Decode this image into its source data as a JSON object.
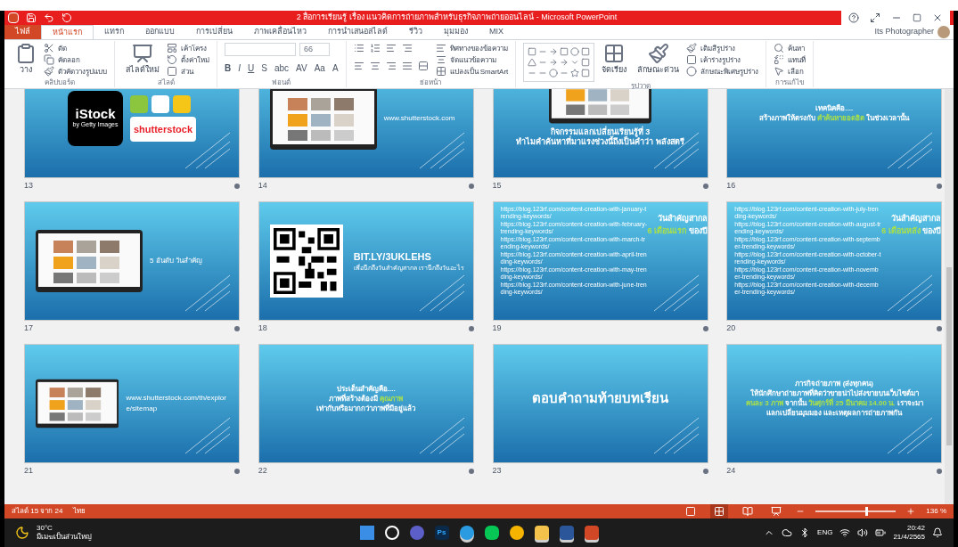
{
  "window": {
    "title": "2 สื่อการเรียนรู้ เรื่อง แนวคิดการถ่ายภาพสำหรับธุรกิจภาพถ่ายออนไลน์ - Microsoft PowerPoint"
  },
  "ribbon": {
    "tabs": [
      {
        "label": "ไฟล์",
        "kind": "file",
        "selected": false
      },
      {
        "label": "หน้าแรก",
        "kind": "tab",
        "selected": true
      },
      {
        "label": "แทรก",
        "kind": "tab",
        "selected": false
      },
      {
        "label": "ออกแบบ",
        "kind": "tab",
        "selected": false
      },
      {
        "label": "การเปลี่ยน",
        "kind": "tab",
        "selected": false
      },
      {
        "label": "ภาพเคลื่อนไหว",
        "kind": "tab",
        "selected": false
      },
      {
        "label": "การนำเสนอสไลด์",
        "kind": "tab",
        "selected": false
      },
      {
        "label": "รีวิว",
        "kind": "tab",
        "selected": false
      },
      {
        "label": "มุมมอง",
        "kind": "tab",
        "selected": false
      },
      {
        "label": "MIX",
        "kind": "tab",
        "selected": false
      }
    ],
    "account": "Its Photographer",
    "groups": [
      {
        "kind": "clipboard",
        "label": "คลิปบอร์ด",
        "big": [
          "วาง"
        ],
        "items": [
          "ตัด",
          "คัดลอก",
          "ตัวคัดวางรูปแบบ"
        ]
      },
      {
        "kind": "slides",
        "label": "สไลด์",
        "big": [
          "สไลด์ใหม่"
        ],
        "items": [
          "เค้าโครง",
          "ตั้งค่าใหม่",
          "ส่วน"
        ]
      },
      {
        "kind": "font",
        "label": "ฟอนต์",
        "font_size": "66",
        "format": [
          "B",
          "I",
          "U",
          "S",
          "abc",
          "AV",
          "Aa",
          "A"
        ]
      },
      {
        "kind": "paragraph",
        "label": "ย่อหน้า",
        "items": [
          "ทิศทางของข้อความ",
          "จัดแนวข้อความ",
          "แปลงเป็น SmartArt"
        ]
      },
      {
        "kind": "drawing",
        "label": "รูปวาด",
        "big": [
          "จัดเรียง",
          "ลักษณะด่วน"
        ],
        "items": [
          "เติมสีรูปร่าง",
          "เค้าร่างรูปร่าง",
          "ลักษณะพิเศษรูปร่าง"
        ]
      },
      {
        "kind": "editing",
        "label": "การแก้ไข",
        "items": [
          "ค้นหา",
          "แทนที่",
          "เลือก"
        ]
      }
    ]
  },
  "slides": [
    {
      "number": "13",
      "kind": "logos",
      "logo_main": "iStock",
      "logo_sub": "by Getty Images",
      "logo_second": "shutterstock"
    },
    {
      "number": "14",
      "kind": "screenshot",
      "caption": [
        [
          {
            "text": "www.shutterstock.com",
            "highlight": false
          }
        ]
      ]
    },
    {
      "number": "15",
      "kind": "screenshot_top",
      "caption": [
        [
          {
            "text": "กิจกรรมแลกเปลี่ยนเรียนรู้ที่ 3",
            "highlight": false
          }
        ],
        [
          {
            "text": "ทำไมคำค้นหาที่มาแรงช่วงนี้ถึงเป็นคำว่า พลังสตรี",
            "highlight": false
          }
        ]
      ]
    },
    {
      "number": "16",
      "kind": "text",
      "lines": [
        [
          {
            "text": "เทคนิคคือ....",
            "highlight": false
          }
        ],
        [
          {
            "text": "สร้างภาพให้ตรงกับ ",
            "highlight": false
          },
          {
            "text": "คำค้นหายอดฮิต",
            "highlight": true
          },
          {
            "text": " ในช่วงเวลานั้น",
            "highlight": false
          }
        ]
      ]
    },
    {
      "number": "17",
      "kind": "screenshot",
      "caption": [
        [
          {
            "text": "5 อันดับ วันสำคัญ",
            "highlight": false
          }
        ]
      ]
    },
    {
      "number": "18",
      "kind": "qr",
      "heading": "BIT.LY/3UKLEHS",
      "subtitle": "เพื่อนึกถึงวันสำคัญสากล เรานึกถึงวันอะไร"
    },
    {
      "number": "19",
      "kind": "links",
      "links": [
        "https://blog.123rf.com/content-creation-with-january-trending-keywords/",
        "https://blog.123rf.com/content-creation-with-february-trending-keywords/",
        "https://blog.123rf.com/content-creation-with-march-trending-keywords/",
        "https://blog.123rf.com/content-creation-with-april-trending-keywords/",
        "https://blog.123rf.com/content-creation-with-may-trending-keywords/",
        "https://blog.123rf.com/content-creation-with-june-trending-keywords/"
      ],
      "lines": [
        [
          {
            "text": "วันสำคัญสากล",
            "highlight": false
          }
        ],
        [
          {
            "text": "6 เดือนแรก",
            "highlight": true
          },
          {
            "text": " ของปี",
            "highlight": false
          }
        ]
      ]
    },
    {
      "number": "20",
      "kind": "links",
      "links": [
        "https://blog.123rf.com/content-creation-with-july-trending-keywords/",
        "https://blog.123rf.com/content-creation-with-august-trending-keywords/",
        "https://blog.123rf.com/content-creation-with-september-trending-keywords/",
        "https://blog.123rf.com/content-creation-with-october-trending-keywords/",
        "https://blog.123rf.com/content-creation-with-november-trending-keywords/",
        "https://blog.123rf.com/content-creation-with-december-trending-keywords/"
      ],
      "lines": [
        [
          {
            "text": "วันสำคัญสากล",
            "highlight": false
          }
        ],
        [
          {
            "text": "6 เดือนหลัง",
            "highlight": true
          },
          {
            "text": " ของปี",
            "highlight": false
          }
        ]
      ]
    },
    {
      "number": "21",
      "kind": "screenshot",
      "caption": [
        [
          {
            "text": "www.shutterstock.com/th/explore/sitemap",
            "highlight": false
          }
        ]
      ]
    },
    {
      "number": "22",
      "kind": "text",
      "lines": [
        [
          {
            "text": "ประเด็นสำคัญคือ....",
            "highlight": false
          }
        ],
        [
          {
            "text": "ภาพที่สร้างต้องมี ",
            "highlight": false
          },
          {
            "text": "คุณภาพ",
            "highlight": true
          }
        ],
        [
          {
            "text": "เท่ากับหรือมากกว่าภาพที่มีอยู่แล้ว",
            "highlight": false
          }
        ]
      ]
    },
    {
      "number": "23",
      "kind": "big_text",
      "lines": [
        [
          {
            "text": "ตอบคำถามท้ายบทเรียน",
            "highlight": false
          }
        ]
      ]
    },
    {
      "number": "24",
      "kind": "text",
      "lines": [
        [
          {
            "text": "ภารกิจถ่ายภาพ (ส่งทุกคน)",
            "highlight": false
          }
        ],
        [
          {
            "text": "ให้นักศึกษาถ่ายภาพที่คิดว่าขายน่าไปส่งขายบนเว็บไซต์มา",
            "highlight": false
          }
        ],
        [
          {
            "text": "คนละ 3 ภาพ",
            "highlight": true
          },
          {
            "text": " จากนั้น ",
            "highlight": false
          },
          {
            "text": "วันศุกร์ที่ 25 มีนาคม 14.00 น.",
            "highlight": true
          },
          {
            "text": " เราจะมา",
            "highlight": false
          }
        ],
        [
          {
            "text": "แลกเปลี่ยนมุมมอง และเหตุผลการถ่ายภาพกัน",
            "highlight": false
          }
        ]
      ]
    }
  ],
  "status_bar": {
    "slide_info": "สไลด์ 15 จาก 24",
    "language": "ไทย",
    "views": [
      {
        "kind": "normal",
        "selected": false
      },
      {
        "kind": "sorter",
        "selected": true
      },
      {
        "kind": "reading",
        "selected": false
      },
      {
        "kind": "show",
        "selected": false
      }
    ],
    "zoom": {
      "level": 0.62,
      "reading": "136 %"
    }
  },
  "taskbar": {
    "weather": {
      "temp": "30°C",
      "text": "มีเมฆเป็นส่วนใหญ่"
    },
    "apps": [
      {
        "kind": "start",
        "active": false
      },
      {
        "kind": "search",
        "active": false
      },
      {
        "kind": "meet",
        "active": false
      },
      {
        "kind": "ps",
        "label": "Ps",
        "active": false
      },
      {
        "kind": "browser",
        "active": true
      },
      {
        "kind": "chat",
        "active": false
      },
      {
        "kind": "globe",
        "active": false
      },
      {
        "kind": "folder",
        "active": true
      },
      {
        "kind": "word",
        "active": true
      },
      {
        "kind": "ppt",
        "active": true
      }
    ],
    "language": "ENG",
    "time": "20:42",
    "date": "21/4/2565"
  }
}
